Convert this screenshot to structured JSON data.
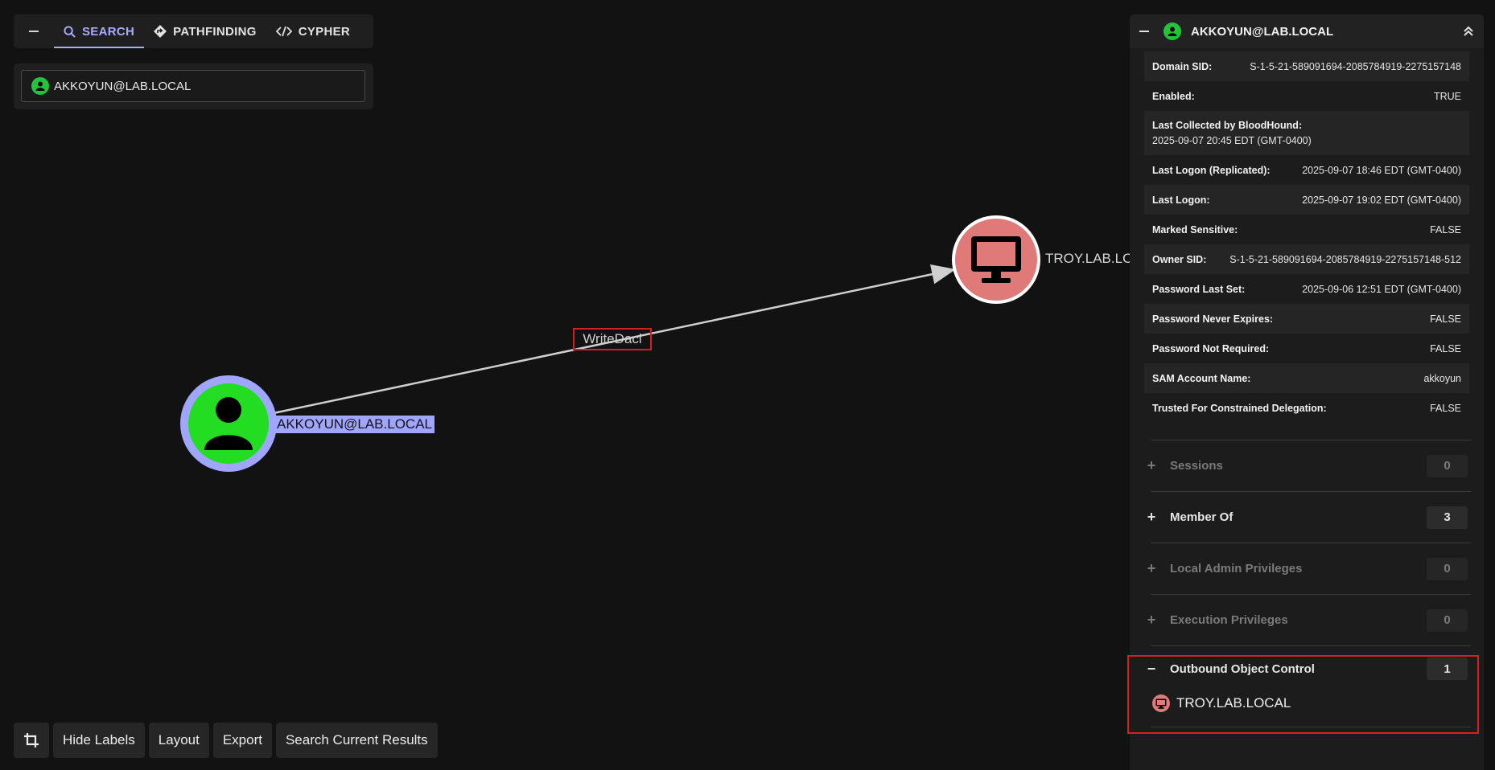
{
  "search_tabs": [
    {
      "label": "SEARCH",
      "icon": "search-icon",
      "active": true
    },
    {
      "label": "PATHFINDING",
      "icon": "pathfinding-icon",
      "active": false
    },
    {
      "label": "CYPHER",
      "icon": "code-icon",
      "active": false
    }
  ],
  "search": {
    "value": "AKKOYUN@LAB.LOCAL",
    "node_type": "user"
  },
  "graph": {
    "source_node": {
      "label": "AKKOYUN@LAB.LOCAL",
      "type": "user",
      "color": "#22dd22",
      "ring_color": "#a0a6ff"
    },
    "target_node": {
      "label": "TROY.LAB.LOCAL",
      "type": "computer",
      "color": "#e07a78"
    },
    "edge": {
      "label": "WriteDacl"
    }
  },
  "toolbar": {
    "crop_icon": "crop-icon",
    "hide_labels": "Hide Labels",
    "layout": "Layout",
    "export": "Export",
    "search_current": "Search Current Results"
  },
  "entity_panel": {
    "title": "AKKOYUN@LAB.LOCAL",
    "properties": [
      {
        "key": "Domain SID:",
        "value": "S-1-5-21-589091694-2085784919-2275157148"
      },
      {
        "key": "Enabled:",
        "value": "TRUE"
      },
      {
        "key": "Last Collected by BloodHound:",
        "value": "2025-09-07 20:45 EDT (GMT-0400)",
        "stacked": true
      },
      {
        "key": "Last Logon (Replicated):",
        "value": "2025-09-07 18:46 EDT (GMT-0400)"
      },
      {
        "key": "Last Logon:",
        "value": "2025-09-07 19:02 EDT (GMT-0400)"
      },
      {
        "key": "Marked Sensitive:",
        "value": "FALSE"
      },
      {
        "key": "Owner SID:",
        "value": "S-1-5-21-589091694-2085784919-2275157148-512"
      },
      {
        "key": "Password Last Set:",
        "value": "2025-09-06 12:51 EDT (GMT-0400)"
      },
      {
        "key": "Password Never Expires:",
        "value": "FALSE"
      },
      {
        "key": "Password Not Required:",
        "value": "FALSE"
      },
      {
        "key": "SAM Account Name:",
        "value": "akkoyun"
      },
      {
        "key": "Trusted For Constrained Delegation:",
        "value": "FALSE"
      }
    ],
    "sections": [
      {
        "label": "Sessions",
        "count": "0",
        "enabled": false
      },
      {
        "label": "Member Of",
        "count": "3",
        "enabled": true
      },
      {
        "label": "Local Admin Privileges",
        "count": "0",
        "enabled": false
      },
      {
        "label": "Execution Privileges",
        "count": "0",
        "enabled": false
      }
    ],
    "outbound": {
      "label": "Outbound Object Control",
      "count": "1",
      "items": [
        "TROY.LAB.LOCAL"
      ]
    }
  }
}
